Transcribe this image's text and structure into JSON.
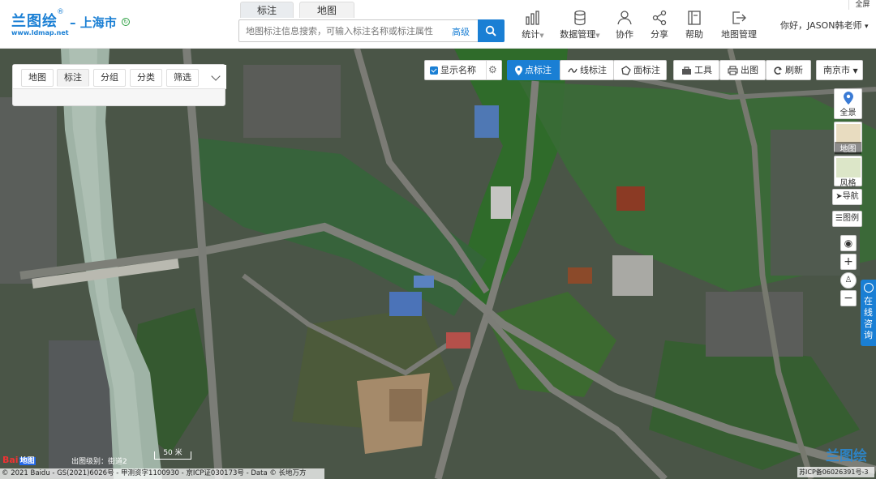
{
  "app": {
    "logo_text": "兰图绘",
    "logo_reg": "®",
    "logo_url": "www.ldmap.net",
    "city": "– 上海市",
    "city_icon": "switch-icon"
  },
  "search": {
    "tabs": [
      {
        "label": "标注",
        "active": true
      },
      {
        "label": "地图",
        "active": false
      }
    ],
    "placeholder": "地图标注信息搜索，可输入标注名称或标注属性",
    "advanced_label": "高级",
    "button_icon": "search-icon"
  },
  "nav": [
    {
      "label": "统计",
      "icon": "bar-chart-icon",
      "caret": true
    },
    {
      "label": "数据管理",
      "icon": "database-icon",
      "caret": true
    },
    {
      "label": "协作",
      "icon": "users-icon",
      "caret": false
    },
    {
      "label": "分享",
      "icon": "share-icon",
      "caret": false
    },
    {
      "label": "帮助",
      "icon": "book-icon",
      "caret": false
    },
    {
      "label": "地图管理",
      "icon": "exit-icon",
      "caret": false
    }
  ],
  "user": {
    "greeting": "你好，JASON韩老师"
  },
  "panel": {
    "tabs": [
      {
        "label": "地图",
        "active": false
      },
      {
        "label": "标注",
        "active": true
      },
      {
        "label": "分组",
        "active": false
      },
      {
        "label": "分类",
        "active": false
      },
      {
        "label": "筛选",
        "active": false
      }
    ]
  },
  "toolbar": {
    "show_name_label": "显示名称",
    "show_name_checked": true,
    "point_label": "点标注",
    "line_label": "线标注",
    "area_label": "面标注",
    "tools_label": "工具",
    "print_label": "出图",
    "refresh_label": "刷新",
    "city_label": "南京市"
  },
  "map_controls": {
    "panorama_label": "全景",
    "map_label": "地图",
    "style_label": "风格",
    "nav_label": "导航",
    "legend_label": "图例"
  },
  "chat": {
    "label": "在线咨询"
  },
  "fullscreen_label": "全屏",
  "map_footer": {
    "baidu_logo": "Bai",
    "baidu_logo_suffix": "地图",
    "zoom_text": "出图级别：街道2",
    "scale_text": "50 米",
    "copyright": "© 2021 Baidu - GS(2021)6026号 - 甲测资字1100930 - 京ICP证030173号 - Data © 长地万方",
    "icp": "苏ICP备06026391号-3",
    "watermark": "兰图绘"
  },
  "colors": {
    "accent": "#1a7fd4",
    "header_bg": "#ffffff"
  }
}
